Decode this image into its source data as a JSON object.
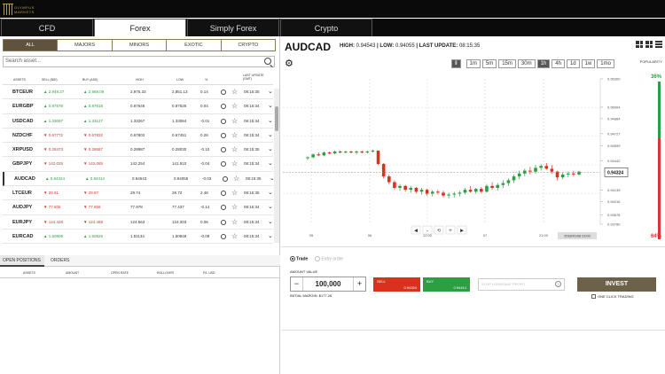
{
  "brand": {
    "logo_text": "OLYMPUS\nMARKETS"
  },
  "tabs": [
    {
      "label": "CFD",
      "active": false
    },
    {
      "label": "Forex",
      "active": true
    },
    {
      "label": "Simply Forex",
      "active": false
    },
    {
      "label": "Crypto",
      "active": false
    }
  ],
  "categories": [
    {
      "label": "ALL",
      "active": true
    },
    {
      "label": "MAJORS",
      "active": false
    },
    {
      "label": "MINORS",
      "active": false
    },
    {
      "label": "EXOTIC",
      "active": false
    },
    {
      "label": "CRYPTO",
      "active": false
    }
  ],
  "search": {
    "placeholder": "Search asset..."
  },
  "table": {
    "headers": {
      "assets": "ASSETS",
      "sell": "SELL (BID)",
      "buy": "BUY (ASK)",
      "high": "HIGH",
      "low": "LOW",
      "pct": "%",
      "update": "LAST UPDATE\n(GMT)"
    },
    "rows": [
      {
        "symbol": "BTCEUR",
        "sell": "2,949.27",
        "buy": "2,969.09",
        "high": "2,975.33",
        "low": "2,851.13",
        "pct": "0.14",
        "time": "08:15:35",
        "dir": "up"
      },
      {
        "symbol": "EURGBP",
        "sell": "0.87578",
        "buy": "0.87618",
        "high": "0.87646",
        "low": "0.87525",
        "pct": "0.04",
        "time": "08:15:34",
        "dir": "up"
      },
      {
        "symbol": "USDCAD",
        "sell": "1.33097",
        "buy": "1.33127",
        "high": "1.33267",
        "low": "1.33084",
        "pct": "-0.01",
        "time": "08:15:34",
        "dir": "up"
      },
      {
        "symbol": "NZDCHF",
        "sell": "0.67772",
        "buy": "0.67832",
        "high": "0.67802",
        "low": "0.67451",
        "pct": "0.26",
        "time": "08:15:34",
        "dir": "dn"
      },
      {
        "symbol": "XRPUSD",
        "sell": "0.28473",
        "buy": "0.28687",
        "high": "0.28987",
        "low": "0.28030",
        "pct": "-0.10",
        "time": "08:15:35",
        "dir": "dn"
      },
      {
        "symbol": "GBPJPY",
        "sell": "142.025",
        "buy": "142.085",
        "high": "142.254",
        "low": "141.910",
        "pct": "-0.04",
        "time": "08:15:34",
        "dir": "dn"
      },
      {
        "symbol": "AUDCAD",
        "sell": "0.94324",
        "buy": "0.94414",
        "high": "0.94543",
        "low": "0.94055",
        "pct": "-0.03",
        "time": "08:15:35",
        "dir": "up",
        "selected": true
      },
      {
        "symbol": "LTCEUR",
        "sell": "29.61",
        "buy": "29.97",
        "high": "29.74",
        "low": "28.72",
        "pct": "2.48",
        "time": "08:15:35",
        "dir": "dn"
      },
      {
        "symbol": "AUDJPY",
        "sell": "77.606",
        "buy": "77.656",
        "high": "77.978",
        "low": "77.437",
        "pct": "-0.14",
        "time": "08:15:34",
        "dir": "dn"
      },
      {
        "symbol": "EURJPY",
        "sell": "124.428",
        "buy": "124.468",
        "high": "124.563",
        "low": "124.303",
        "pct": "0.06",
        "time": "08:15:34",
        "dir": "dn"
      },
      {
        "symbol": "EURCAD",
        "sell": "1.50806",
        "buy": "1.50826",
        "high": "1.51134",
        "low": "1.50849",
        "pct": "-0.09",
        "time": "08:15:34",
        "dir": "up"
      },
      {
        "symbol": "NZDUSD",
        "sell": "0.67493",
        "buy": "0.67560",
        "high": "0.67240",
        "low": "0.67235",
        "pct": "0.08",
        "time": "08:15:34",
        "dir": "up"
      }
    ]
  },
  "bottom": {
    "tab_open": "OPEN POSITIONS",
    "tab_orders": "ORDERS",
    "headers": {
      "assets": "ASSETS",
      "amount": "AMOUNT",
      "open_rate": "OPEN RATE",
      "rollover": "ROLLOVER",
      "pl": "P/L USD"
    }
  },
  "instrument": {
    "pair": "AUDCAD",
    "high_label": "HIGH:",
    "high": "0.94543",
    "low_label": "LOW:",
    "low": "0.94055",
    "update_label": "LAST UPDATE:",
    "update": "08:15:35"
  },
  "timeframes": [
    "1m",
    "5m",
    "15m",
    "30m",
    "1h",
    "4h",
    "1d",
    "1w",
    "1mo"
  ],
  "timeframe_active": "1h",
  "chart_tools": [
    "candle-chart-icon",
    "line-chart-icon"
  ],
  "popularity": {
    "label": "POPULARITY",
    "buy_pct": "36%",
    "sell_pct": "64%",
    "buy_value": 36
  },
  "chart_data": {
    "type": "candlestick",
    "y_ticks": [
      "0.95300",
      "0.95004",
      "0.94884",
      "0.94727",
      "0.94599",
      "0.94442",
      "0.94324",
      "0.94135",
      "0.94016",
      "0.93878",
      "0.93780"
    ],
    "x_ticks": [
      "05",
      "06",
      "12:00",
      "07",
      "21:00"
    ],
    "current_price": "0.94324",
    "crosshair_time": "2018/01/08 23:00",
    "nav": [
      "◀",
      "–",
      "⟲",
      "+",
      "▶"
    ],
    "candles": [
      [
        0.9447,
        0.9449,
        0.9445,
        0.9448
      ],
      [
        0.9448,
        0.9452,
        0.9447,
        0.9451
      ],
      [
        0.9451,
        0.9453,
        0.9449,
        0.945
      ],
      [
        0.945,
        0.9454,
        0.9449,
        0.9453
      ],
      [
        0.9453,
        0.9454,
        0.9451,
        0.9452
      ],
      [
        0.9452,
        0.9455,
        0.9451,
        0.9454
      ],
      [
        0.9454,
        0.9455,
        0.9452,
        0.9453
      ],
      [
        0.9453,
        0.9455,
        0.9452,
        0.9454
      ],
      [
        0.9454,
        0.9455,
        0.9452,
        0.9453
      ],
      [
        0.9453,
        0.9455,
        0.9451,
        0.9454
      ],
      [
        0.9454,
        0.9455,
        0.9452,
        0.9453
      ],
      [
        0.9453,
        0.9455,
        0.9452,
        0.9454
      ],
      [
        0.9454,
        0.9456,
        0.9453,
        0.9455
      ],
      [
        0.9455,
        0.9455,
        0.944,
        0.9441
      ],
      [
        0.9441,
        0.9442,
        0.9426,
        0.9428
      ],
      [
        0.9428,
        0.943,
        0.942,
        0.9422
      ],
      [
        0.9422,
        0.9424,
        0.9414,
        0.9416
      ],
      [
        0.9416,
        0.942,
        0.9413,
        0.9418
      ],
      [
        0.9418,
        0.9419,
        0.9412,
        0.9414
      ],
      [
        0.9414,
        0.9418,
        0.9411,
        0.9416
      ],
      [
        0.9416,
        0.9417,
        0.941,
        0.9412
      ],
      [
        0.9412,
        0.9416,
        0.9409,
        0.9414
      ],
      [
        0.9414,
        0.9415,
        0.9408,
        0.941
      ],
      [
        0.941,
        0.9414,
        0.9407,
        0.9412
      ],
      [
        0.9412,
        0.9414,
        0.9409,
        0.9411
      ],
      [
        0.9411,
        0.9413,
        0.9406,
        0.9408
      ],
      [
        0.9408,
        0.9411,
        0.9405,
        0.9409
      ],
      [
        0.9409,
        0.9412,
        0.9406,
        0.941
      ],
      [
        0.941,
        0.9413,
        0.9407,
        0.9411
      ],
      [
        0.9411,
        0.9416,
        0.9409,
        0.9414
      ],
      [
        0.9414,
        0.9418,
        0.9411,
        0.9412
      ],
      [
        0.9412,
        0.9416,
        0.941,
        0.9415
      ],
      [
        0.9415,
        0.9417,
        0.941,
        0.9412
      ],
      [
        0.9412,
        0.942,
        0.9411,
        0.9418
      ],
      [
        0.9418,
        0.9422,
        0.9414,
        0.9416
      ],
      [
        0.9416,
        0.9421,
        0.9413,
        0.9419
      ],
      [
        0.9419,
        0.9424,
        0.9416,
        0.9421
      ],
      [
        0.9421,
        0.9426,
        0.9418,
        0.9424
      ],
      [
        0.9424,
        0.943,
        0.9421,
        0.9428
      ],
      [
        0.9428,
        0.9434,
        0.9425,
        0.9431
      ],
      [
        0.9431,
        0.9436,
        0.9428,
        0.9434
      ],
      [
        0.9434,
        0.9438,
        0.943,
        0.9433
      ],
      [
        0.9433,
        0.944,
        0.9431,
        0.9437
      ],
      [
        0.9437,
        0.9441,
        0.9434,
        0.9439
      ],
      [
        0.9439,
        0.9442,
        0.9435,
        0.9436
      ],
      [
        0.9436,
        0.944,
        0.9431,
        0.9433
      ],
      [
        0.9433,
        0.9434,
        0.9424,
        0.9427
      ],
      [
        0.9427,
        0.9432,
        0.9425,
        0.943
      ],
      [
        0.943,
        0.9433,
        0.9427,
        0.9431
      ],
      [
        0.9431,
        0.9434,
        0.9428,
        0.943
      ],
      [
        0.943,
        0.9434,
        0.9429,
        0.9433
      ]
    ]
  },
  "order": {
    "mode_trade": "Trade",
    "mode_entry": "Entry order",
    "amount_label": "AMOUNT VALUE",
    "amount": "100,000",
    "minus": "−",
    "plus": "+",
    "margin": "INITIAL MARGIN: $177.26",
    "sell_label": "SELL",
    "sell_price": "0.94324",
    "buy_label": "BUY",
    "buy_price": "0.94414",
    "stop_placeholder": "STOP LOSS/TAKE PROFIT",
    "invest": "INVEST",
    "one_click": "ONE CLICK TRADING"
  }
}
